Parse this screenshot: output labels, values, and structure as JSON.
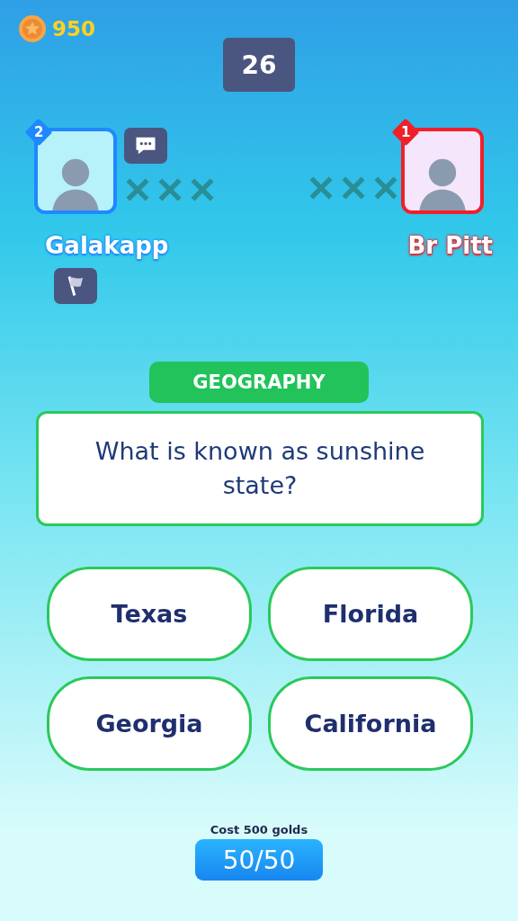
{
  "coins": "950",
  "timer": "26",
  "players": [
    {
      "name": "Galakapp",
      "rank": "2",
      "color": "#1e88ff",
      "kind": "player"
    },
    {
      "name": "Br Pitt",
      "rank": "1",
      "color": "#f0202a",
      "kind": "opponent"
    }
  ],
  "category": "GEOGRAPHY",
  "question": "What is known as sunshine state?",
  "answers": [
    "Texas",
    "Florida",
    "Georgia",
    "California"
  ],
  "lifeline": {
    "cost": "Cost 500 golds",
    "label": "50/50"
  }
}
